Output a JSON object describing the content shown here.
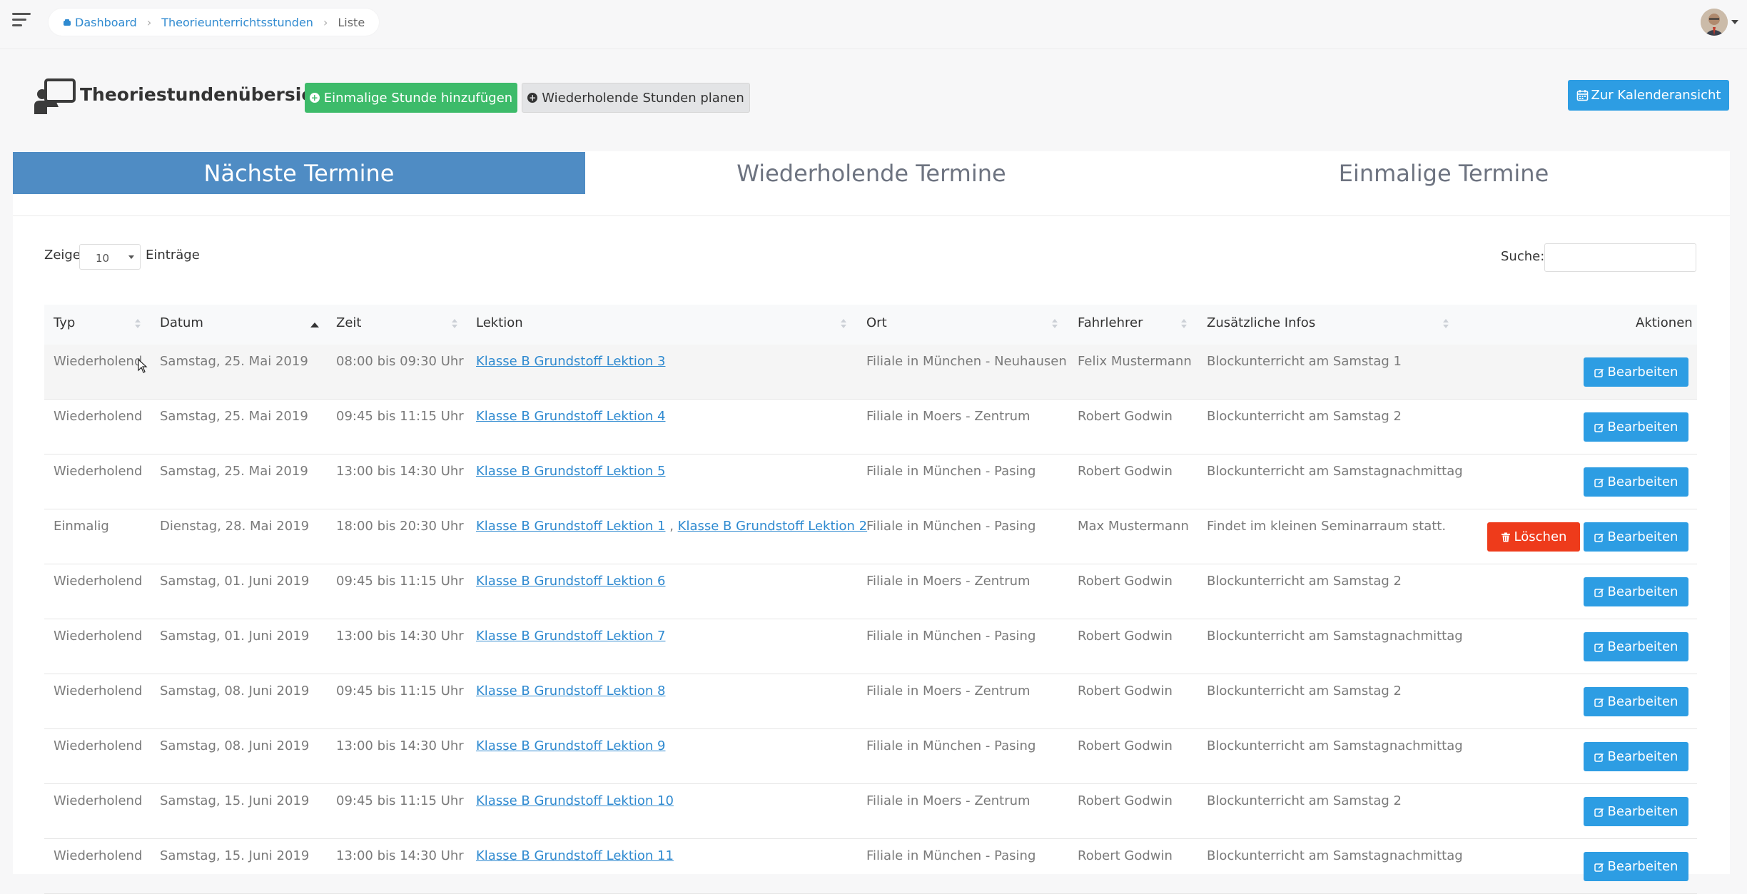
{
  "breadcrumb": {
    "home": "Dashboard",
    "section": "Theorieunterrichtsstunden",
    "current": "Liste"
  },
  "header": {
    "title": "Theoriestundenübersicht",
    "add_single_label": "Einmalige Stunde hinzufügen",
    "plan_recurring_label": "Wiederholende Stunden planen",
    "calendar_label": "Zur Kalenderansicht"
  },
  "tabs": [
    {
      "label": "Nächste Termine",
      "active": true
    },
    {
      "label": "Wiederholende Termine",
      "active": false
    },
    {
      "label": "Einmalige Termine",
      "active": false
    }
  ],
  "table_controls": {
    "show_label": "Zeige",
    "page_length": "10",
    "entries_label": "Einträge",
    "search_label": "Suche:",
    "search_value": ""
  },
  "columns": [
    "Typ",
    "Datum",
    "Zeit",
    "Lektion",
    "Ort",
    "Fahrlehrer",
    "Zusätzliche Infos",
    "Aktionen"
  ],
  "actions": {
    "edit_label": "Bearbeiten",
    "delete_label": "Löschen"
  },
  "rows": [
    {
      "typ": "Wiederholend",
      "datum": "Samstag, 25. Mai 2019",
      "zeit": "08:00 bis 09:30 Uhr",
      "lektionen": [
        "Klasse B Grundstoff Lektion 3"
      ],
      "ort": "Filiale in München - Neuhausen",
      "fahrlehrer": "Felix Mustermann",
      "infos": "Blockunterricht am Samstag 1",
      "deletable": false
    },
    {
      "typ": "Wiederholend",
      "datum": "Samstag, 25. Mai 2019",
      "zeit": "09:45 bis 11:15 Uhr",
      "lektionen": [
        "Klasse B Grundstoff Lektion 4"
      ],
      "ort": "Filiale in Moers - Zentrum",
      "fahrlehrer": "Robert Godwin",
      "infos": "Blockunterricht am Samstag 2",
      "deletable": false
    },
    {
      "typ": "Wiederholend",
      "datum": "Samstag, 25. Mai 2019",
      "zeit": "13:00 bis 14:30 Uhr",
      "lektionen": [
        "Klasse B Grundstoff Lektion 5"
      ],
      "ort": "Filiale in München - Pasing",
      "fahrlehrer": "Robert Godwin",
      "infos": "Blockunterricht am Samstagnachmittag",
      "deletable": false
    },
    {
      "typ": "Einmalig",
      "datum": "Dienstag, 28. Mai 2019",
      "zeit": "18:00 bis 20:30 Uhr",
      "lektionen": [
        "Klasse B Grundstoff Lektion 1",
        "Klasse B Grundstoff Lektion 2"
      ],
      "ort": "Filiale in München - Pasing",
      "fahrlehrer": "Max Mustermann",
      "infos": "Findet im kleinen Seminarraum statt.",
      "deletable": true
    },
    {
      "typ": "Wiederholend",
      "datum": "Samstag, 01. Juni 2019",
      "zeit": "09:45 bis 11:15 Uhr",
      "lektionen": [
        "Klasse B Grundstoff Lektion 6"
      ],
      "ort": "Filiale in Moers - Zentrum",
      "fahrlehrer": "Robert Godwin",
      "infos": "Blockunterricht am Samstag 2",
      "deletable": false
    },
    {
      "typ": "Wiederholend",
      "datum": "Samstag, 01. Juni 2019",
      "zeit": "13:00 bis 14:30 Uhr",
      "lektionen": [
        "Klasse B Grundstoff Lektion 7"
      ],
      "ort": "Filiale in München - Pasing",
      "fahrlehrer": "Robert Godwin",
      "infos": "Blockunterricht am Samstagnachmittag",
      "deletable": false
    },
    {
      "typ": "Wiederholend",
      "datum": "Samstag, 08. Juni 2019",
      "zeit": "09:45 bis 11:15 Uhr",
      "lektionen": [
        "Klasse B Grundstoff Lektion 8"
      ],
      "ort": "Filiale in Moers - Zentrum",
      "fahrlehrer": "Robert Godwin",
      "infos": "Blockunterricht am Samstag 2",
      "deletable": false
    },
    {
      "typ": "Wiederholend",
      "datum": "Samstag, 08. Juni 2019",
      "zeit": "13:00 bis 14:30 Uhr",
      "lektionen": [
        "Klasse B Grundstoff Lektion 9"
      ],
      "ort": "Filiale in München - Pasing",
      "fahrlehrer": "Robert Godwin",
      "infos": "Blockunterricht am Samstagnachmittag",
      "deletable": false
    },
    {
      "typ": "Wiederholend",
      "datum": "Samstag, 15. Juni 2019",
      "zeit": "09:45 bis 11:15 Uhr",
      "lektionen": [
        "Klasse B Grundstoff Lektion 10"
      ],
      "ort": "Filiale in Moers - Zentrum",
      "fahrlehrer": "Robert Godwin",
      "infos": "Blockunterricht am Samstag 2",
      "deletable": false
    },
    {
      "typ": "Wiederholend",
      "datum": "Samstag, 15. Juni 2019",
      "zeit": "13:00 bis 14:30 Uhr",
      "lektionen": [
        "Klasse B Grundstoff Lektion 11"
      ],
      "ort": "Filiale in München - Pasing",
      "fahrlehrer": "Robert Godwin",
      "infos": "Blockunterricht am Samstagnachmittag",
      "deletable": false
    }
  ]
}
